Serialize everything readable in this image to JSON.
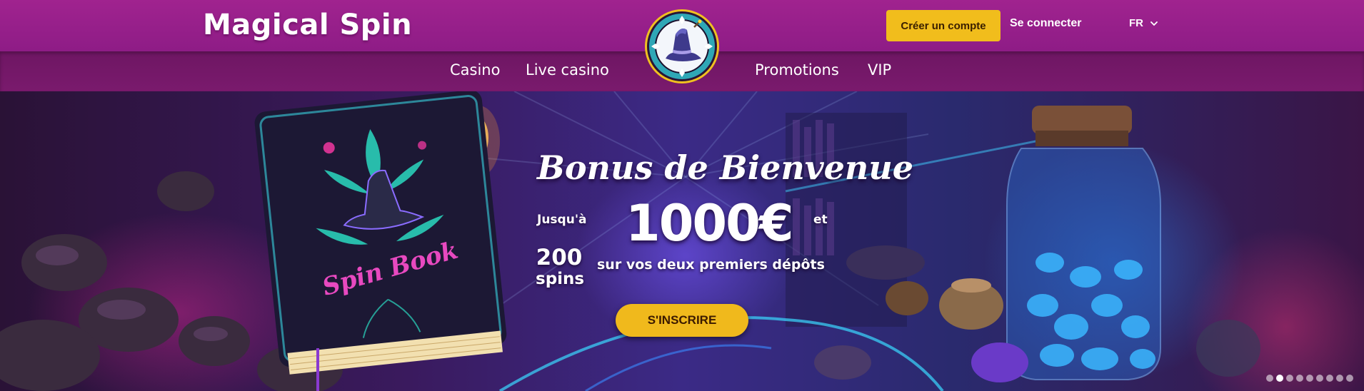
{
  "header": {
    "logo": "Magical Spin",
    "register_label": "Créer un compte",
    "login_label": "Se connecter",
    "language": "FR"
  },
  "nav": {
    "items": [
      {
        "label": "Casino"
      },
      {
        "label": "Live casino"
      },
      {
        "label": "Promotions"
      },
      {
        "label": "VIP"
      }
    ]
  },
  "hero": {
    "title": "Bonus de Bienvenue",
    "up_to": "Jusqu'à",
    "amount": "1000€",
    "and": "et",
    "spins_count": "200",
    "spins_word": "spins",
    "deposit_text": "sur vos deux premiers dépôts",
    "cta_label": "S'INSCRIRE",
    "book_title": "Spin Book"
  },
  "carousel": {
    "slide_count": 9,
    "active_index": 1
  },
  "colors": {
    "header_bg": "#9a218c",
    "nav_bg": "#74186a",
    "button_yellow": "#f1bd1c"
  }
}
